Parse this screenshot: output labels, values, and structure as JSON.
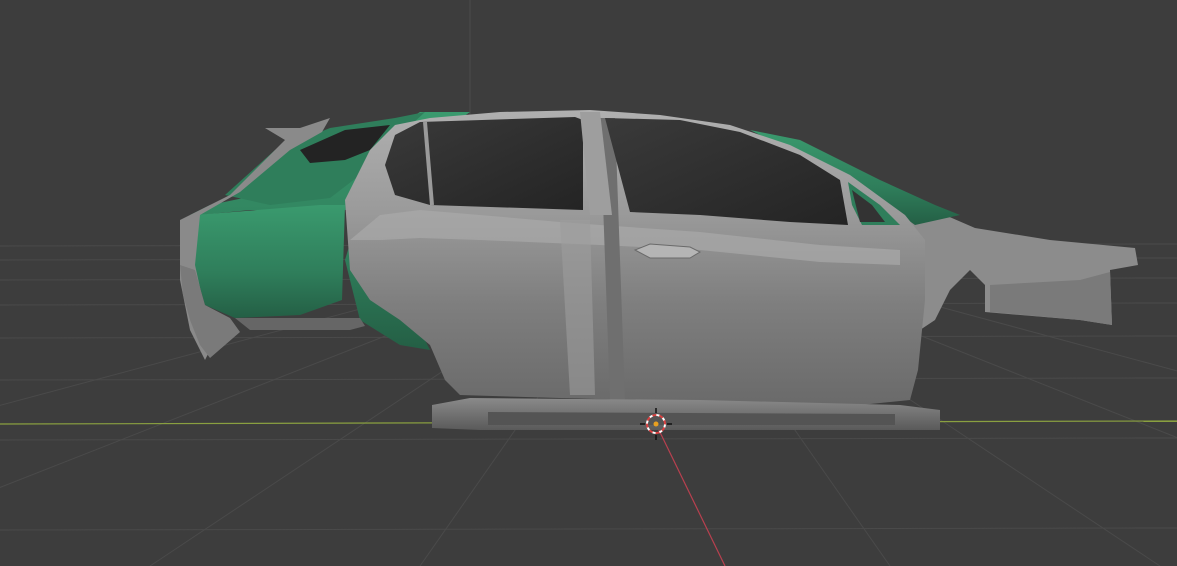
{
  "viewport": {
    "mode": "3d-viewport",
    "object_visible": "car-body-shell",
    "colors": {
      "background": "#3d3d3d",
      "grid": "#4a4a4a",
      "axis_x": "#b8404f",
      "axis_y": "#8aa040",
      "body_gray": "#8d8d8d",
      "inner_green": "#2f7e5b",
      "glass": "#2a2a2a"
    },
    "icons": {
      "cursor": "3d-cursor-icon"
    }
  }
}
